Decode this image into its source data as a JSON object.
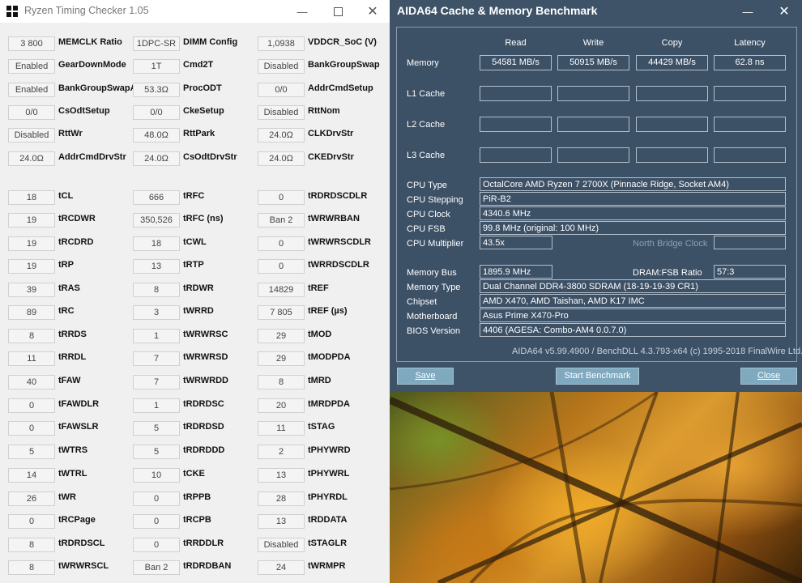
{
  "rtc": {
    "title": "Ryzen Timing Checker 1.05",
    "rows": [
      [
        [
          "3 800",
          "MEMCLK Ratio"
        ],
        [
          "1DPC-SR",
          "DIMM Config"
        ],
        [
          "1,0938",
          "VDDCR_SoC (V)"
        ]
      ],
      [
        [
          "Enabled",
          "GearDownMode"
        ],
        [
          "1T",
          "Cmd2T"
        ],
        [
          "Disabled",
          "BankGroupSwap"
        ]
      ],
      [
        [
          "Enabled",
          "BankGroupSwapAlt"
        ],
        [
          "53.3Ω",
          "ProcODT"
        ],
        [
          "0/0",
          "AddrCmdSetup"
        ]
      ],
      [
        [
          "0/0",
          "CsOdtSetup"
        ],
        [
          "0/0",
          "CkeSetup"
        ],
        [
          "Disabled",
          "RttNom"
        ]
      ],
      [
        [
          "Disabled",
          "RttWr"
        ],
        [
          "48.0Ω",
          "RttPark"
        ],
        [
          "24.0Ω",
          "CLKDrvStr"
        ]
      ],
      [
        [
          "24.0Ω",
          "AddrCmdDrvStr"
        ],
        [
          "24.0Ω",
          "CsOdtDrvStr"
        ],
        [
          "24.0Ω",
          "CKEDrvStr"
        ]
      ],
      [
        [
          "18",
          "tCL"
        ],
        [
          "666",
          "tRFC"
        ],
        [
          "0",
          "tRDRDSCDLR"
        ]
      ],
      [
        [
          "19",
          "tRCDWR"
        ],
        [
          "350,526",
          "tRFC (ns)"
        ],
        [
          "Ban 2",
          "tWRWRBAN"
        ]
      ],
      [
        [
          "19",
          "tRCDRD"
        ],
        [
          "18",
          "tCWL"
        ],
        [
          "0",
          "tWRWRSCDLR"
        ]
      ],
      [
        [
          "19",
          "tRP"
        ],
        [
          "13",
          "tRTP"
        ],
        [
          "0",
          "tWRRDSCDLR"
        ]
      ],
      [
        [
          "39",
          "tRAS"
        ],
        [
          "8",
          "tRDWR"
        ],
        [
          "14829",
          "tREF"
        ]
      ],
      [
        [
          "89",
          "tRC"
        ],
        [
          "3",
          "tWRRD"
        ],
        [
          "7 805",
          "tREF (µs)"
        ]
      ],
      [
        [
          "8",
          "tRRDS"
        ],
        [
          "1",
          "tWRWRSC"
        ],
        [
          "29",
          "tMOD"
        ]
      ],
      [
        [
          "11",
          "tRRDL"
        ],
        [
          "7",
          "tWRWRSD"
        ],
        [
          "29",
          "tMODPDA"
        ]
      ],
      [
        [
          "40",
          "tFAW"
        ],
        [
          "7",
          "tWRWRDD"
        ],
        [
          "8",
          "tMRD"
        ]
      ],
      [
        [
          "0",
          "tFAWDLR"
        ],
        [
          "1",
          "tRDRDSC"
        ],
        [
          "20",
          "tMRDPDA"
        ]
      ],
      [
        [
          "0",
          "tFAWSLR"
        ],
        [
          "5",
          "tRDRDSD"
        ],
        [
          "11",
          "tSTAG"
        ]
      ],
      [
        [
          "5",
          "tWTRS"
        ],
        [
          "5",
          "tRDRDDD"
        ],
        [
          "2",
          "tPHYWRD"
        ]
      ],
      [
        [
          "14",
          "tWTRL"
        ],
        [
          "10",
          "tCKE"
        ],
        [
          "13",
          "tPHYWRL"
        ]
      ],
      [
        [
          "26",
          "tWR"
        ],
        [
          "0",
          "tRPPB"
        ],
        [
          "28",
          "tPHYRDL"
        ]
      ],
      [
        [
          "0",
          "tRCPage"
        ],
        [
          "0",
          "tRCPB"
        ],
        [
          "13",
          "tRDDATA"
        ]
      ],
      [
        [
          "8",
          "tRDRDSCL"
        ],
        [
          "0",
          "tRRDDLR"
        ],
        [
          "Disabled",
          "tSTAGLR"
        ]
      ],
      [
        [
          "8",
          "tWRWRSCL"
        ],
        [
          "Ban 2",
          "tRDRDBAN"
        ],
        [
          "24",
          "tWRMPR"
        ]
      ]
    ]
  },
  "aida": {
    "title": "AIDA64 Cache & Memory Benchmark",
    "columns": [
      "Read",
      "Write",
      "Copy",
      "Latency"
    ],
    "bench_rows": [
      {
        "label": "Memory",
        "values": [
          "54581 MB/s",
          "50915 MB/s",
          "44429 MB/s",
          "62.8 ns"
        ]
      },
      {
        "label": "L1 Cache",
        "values": [
          "",
          "",
          "",
          ""
        ]
      },
      {
        "label": "L2 Cache",
        "values": [
          "",
          "",
          "",
          ""
        ]
      },
      {
        "label": "L3 Cache",
        "values": [
          "",
          "",
          "",
          ""
        ]
      }
    ],
    "cpu_type_label": "CPU Type",
    "cpu_type": "OctalCore AMD Ryzen 7 2700X  (Pinnacle Ridge, Socket AM4)",
    "cpu_stepping_label": "CPU Stepping",
    "cpu_stepping": "PiR-B2",
    "cpu_clock_label": "CPU Clock",
    "cpu_clock": "4340.6 MHz",
    "cpu_fsb_label": "CPU FSB",
    "cpu_fsb": "99.8 MHz  (original: 100 MHz)",
    "cpu_mult_label": "CPU Multiplier",
    "cpu_mult": "43.5x",
    "nb_clock_label": "North Bridge Clock",
    "mem_bus_label": "Memory Bus",
    "mem_bus": "1895.9 MHz",
    "dram_fsb_label": "DRAM:FSB Ratio",
    "dram_fsb": "57:3",
    "mem_type_label": "Memory Type",
    "mem_type": "Dual Channel DDR4-3800 SDRAM  (18-19-19-39 CR1)",
    "chipset_label": "Chipset",
    "chipset": "AMD X470, AMD Taishan, AMD K17 IMC",
    "motherboard_label": "Motherboard",
    "motherboard": "Asus Prime X470-Pro",
    "bios_label": "BIOS Version",
    "bios": "4406  (AGESA: Combo-AM4 0.0.7.0)",
    "footer": "AIDA64 v5.99.4900 / BenchDLL 4.3.793-x64  (c) 1995-2018 FinalWire Ltd.",
    "save_label": "Save",
    "start_label": "Start Benchmark",
    "close_label": "Close"
  }
}
